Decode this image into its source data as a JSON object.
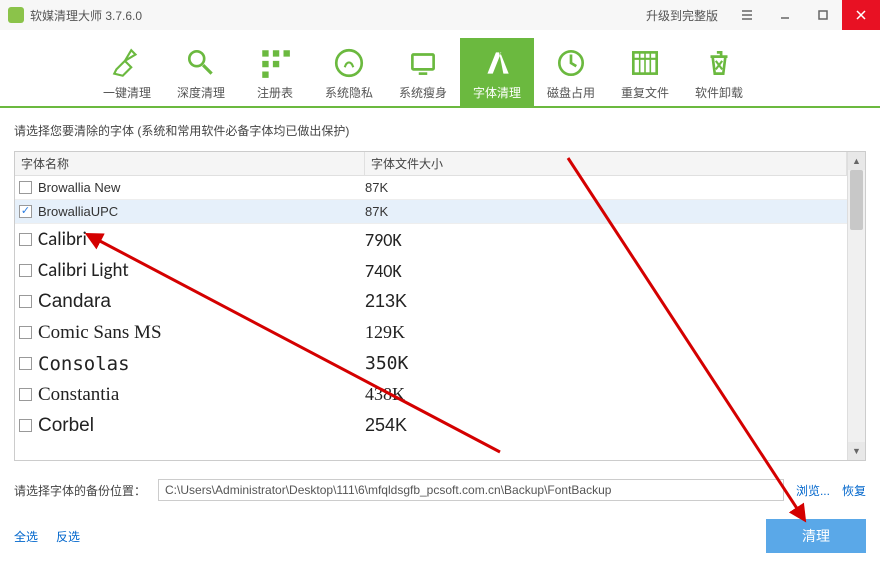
{
  "titlebar": {
    "title": "软媒清理大师 3.7.6.0",
    "upgrade": "升级到完整版"
  },
  "toolbar": {
    "items": [
      {
        "label": "一键清理"
      },
      {
        "label": "深度清理"
      },
      {
        "label": "注册表"
      },
      {
        "label": "系统隐私"
      },
      {
        "label": "系统瘦身"
      },
      {
        "label": "字体清理"
      },
      {
        "label": "磁盘占用"
      },
      {
        "label": "重复文件"
      },
      {
        "label": "软件卸载"
      }
    ],
    "active_index": 5
  },
  "prompt": "请选择您要清除的字体 (系统和常用软件必备字体均已做出保护)",
  "columns": {
    "name": "字体名称",
    "size": "字体文件大小"
  },
  "fonts": [
    {
      "name": "Browallia New",
      "size": "87K",
      "family": "sans-serif",
      "big": false,
      "checked": false
    },
    {
      "name": "BrowalliaUPC",
      "size": "87K",
      "family": "sans-serif",
      "big": false,
      "checked": true
    },
    {
      "name": "Calibri",
      "size": "790K",
      "family": "Calibri, sans-serif",
      "big": true,
      "checked": false
    },
    {
      "name": "Calibri Light",
      "size": "740K",
      "family": "Calibri, sans-serif",
      "big": true,
      "checked": false
    },
    {
      "name": "Candara",
      "size": "213K",
      "family": "Candara, sans-serif",
      "big": true,
      "checked": false
    },
    {
      "name": "Comic Sans MS",
      "size": "129K",
      "family": "'Comic Sans MS', cursive",
      "big": true,
      "checked": false
    },
    {
      "name": "Consolas",
      "size": "350K",
      "family": "Consolas, monospace",
      "big": true,
      "checked": false
    },
    {
      "name": "Constantia",
      "size": "438K",
      "family": "Constantia, serif",
      "big": true,
      "checked": false
    },
    {
      "name": "Corbel",
      "size": "254K",
      "family": "Corbel, sans-serif",
      "big": true,
      "checked": false
    }
  ],
  "backup": {
    "label": "请选择字体的备份位置：",
    "path": "C:\\Users\\Administrator\\Desktop\\111\\6\\mfqldsgfb_pcsoft.com.cn\\Backup\\FontBackup",
    "browse": "浏览...",
    "restore": "恢复"
  },
  "actions": {
    "select_all": "全选",
    "invert": "反选",
    "clean": "清理"
  }
}
